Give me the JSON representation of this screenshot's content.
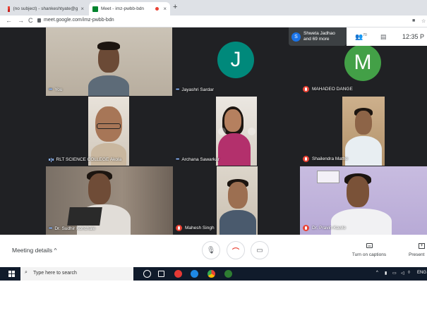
{
  "browser": {
    "tabs": [
      {
        "label": "(no subject) - shankeshtyate@g",
        "icon": "gmail-icon",
        "active": false
      },
      {
        "label": "Meet - imz-pwbb-bdn",
        "icon": "meet-icon",
        "active": true
      }
    ],
    "url": "meet.google.com/imz-pwbb-bdn"
  },
  "participants_card": {
    "initial": "S",
    "line1": "Shweta Jadhao",
    "line2": "and 69 more"
  },
  "topbar": {
    "clock": "12:35 P",
    "people_count": "70"
  },
  "tiles": [
    {
      "name": "You",
      "state": "speaking"
    },
    {
      "name": "Jayashri Sardar",
      "state": "speaking",
      "avatar": "J",
      "avatar_color": "#00897b"
    },
    {
      "name": "MAHADEO DANGE",
      "state": "muted",
      "avatar": "M",
      "avatar_color": "#43a047"
    },
    {
      "name": "RLT SCIENCE COLLEGE Akola",
      "state": "active"
    },
    {
      "name": "Archana Sawarkar",
      "state": "speaking"
    },
    {
      "name": "Shailendra Mathe",
      "state": "muted"
    },
    {
      "name": "Dr. Sudhir Kohchale",
      "state": "speaking"
    },
    {
      "name": "Mahesh Singh",
      "state": "muted"
    },
    {
      "name": "Dr. Pravin Kawle",
      "state": "muted"
    }
  ],
  "bottombar": {
    "meeting_details": "Meeting details",
    "captions": "Turn on captions",
    "present": "Present"
  },
  "taskbar": {
    "search_placeholder": "Type here to search",
    "lang": "ENG"
  },
  "colors": {
    "meet_bg": "#202124",
    "end_call": "#ea4335",
    "accent": "#1a73e8"
  }
}
